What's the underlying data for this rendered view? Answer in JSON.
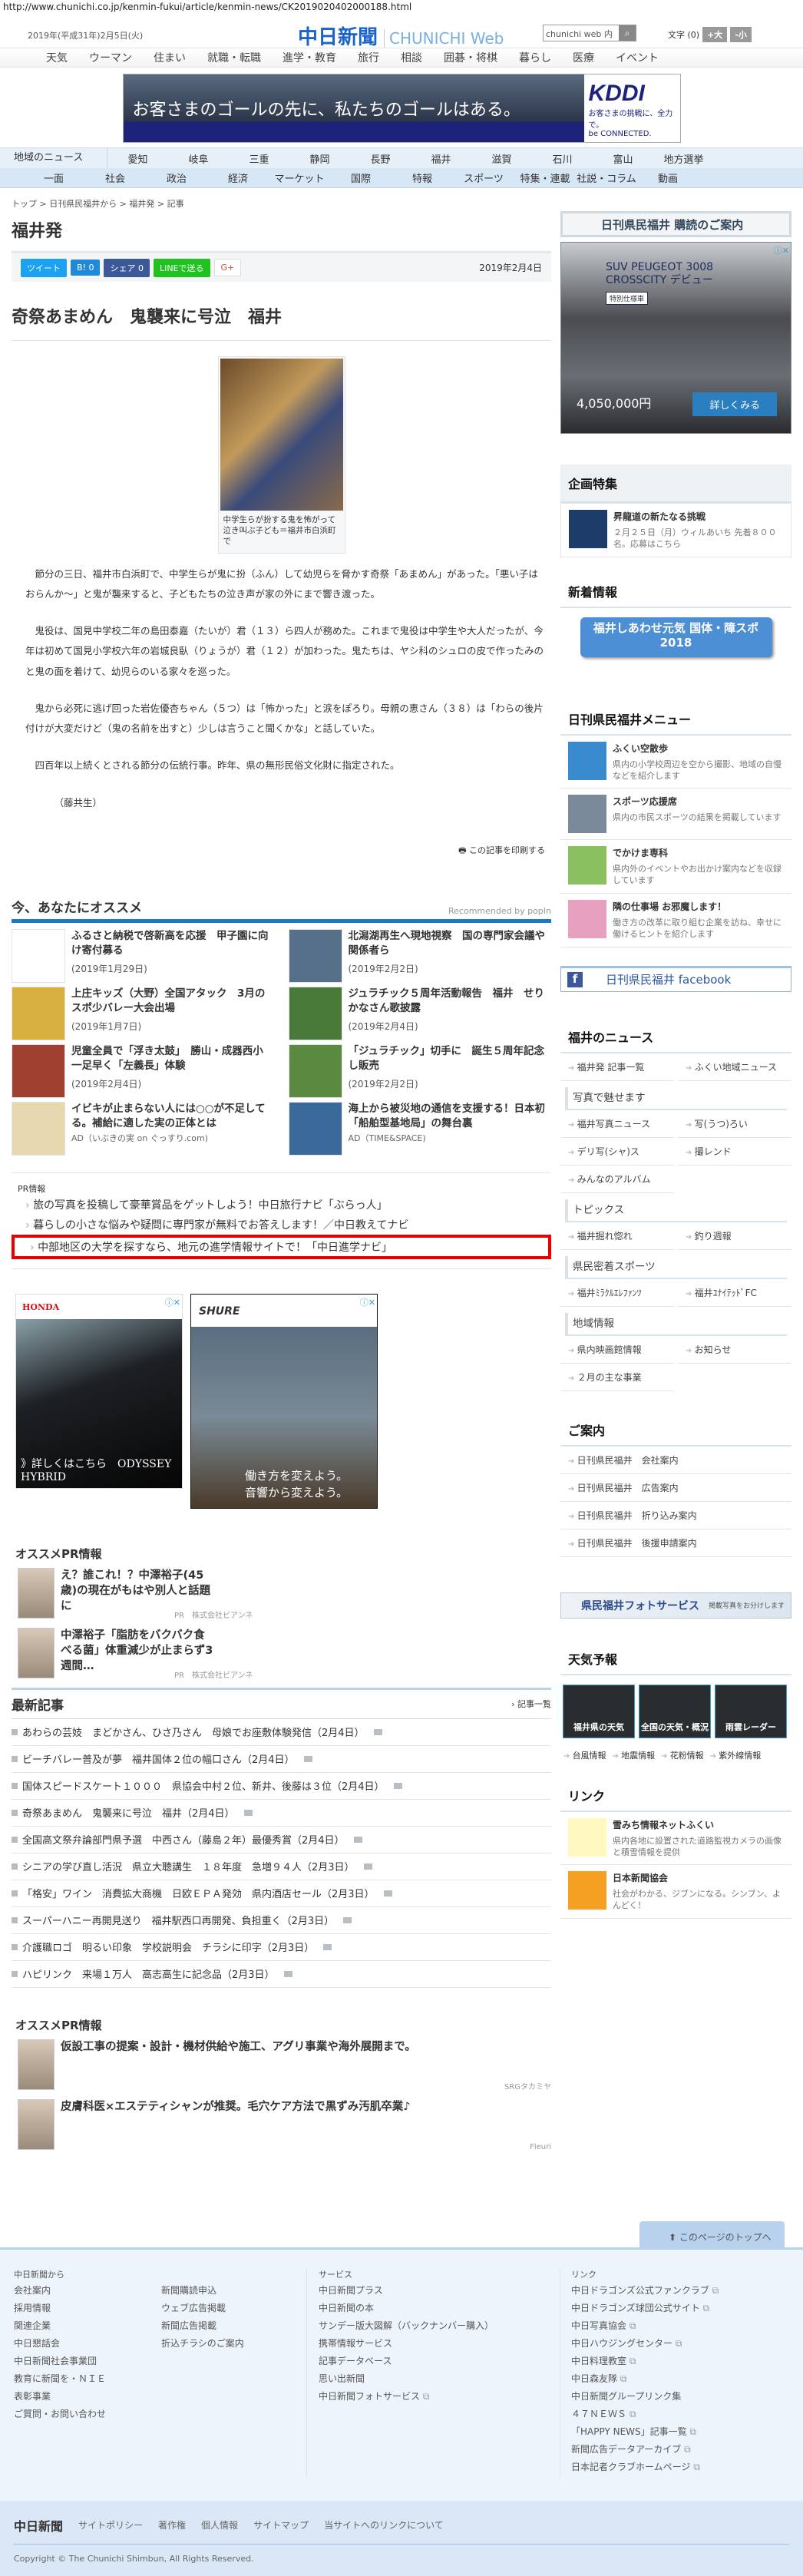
{
  "url": "http://www.chunichi.co.jp/kenmin-fukui/article/kenmin-news/CK2019020402000188.html",
  "header": {
    "date": "2019年(平成31年)2月5日(火)",
    "logo_jp": "中日新聞",
    "logo_en": "CHUNICHI Web",
    "search_placeholder": "chunichi web 内",
    "font_label": "文字 (0)",
    "font_up": "+大",
    "font_down": "-小"
  },
  "global_nav": [
    "天気",
    "ウーマン",
    "住まい",
    "就職・転職",
    "進学・教育",
    "旅行",
    "相談",
    "囲碁・将棋",
    "暮らし",
    "医療",
    "イベント"
  ],
  "top_ad": {
    "text": "お客さまのゴールの先に、私たちのゴールはある。",
    "brand": "KDDI",
    "sub": "お客さまの挑戦に、全力で。",
    "tag": "be CONNECTED."
  },
  "region_nav": {
    "label": "地域のニュース",
    "items": [
      "愛知",
      "岐阜",
      "三重",
      "静岡",
      "長野",
      "福井",
      "滋賀",
      "石川",
      "富山",
      "地方選挙"
    ]
  },
  "category_nav": [
    "一面",
    "社会",
    "政治",
    "経済",
    "マーケット",
    "国際",
    "特報",
    "スポーツ",
    "特集・連載",
    "社説・コラム",
    "動画"
  ],
  "breadcrumb": "トップ > 日刊県民福井から > 福井発 > 記事",
  "section_title": "福井発",
  "share": {
    "tweet": "ツイート",
    "hatena": "B! 0",
    "facebook": "シェア 0",
    "line": "LINEで送る",
    "gplus": "G+",
    "date": "2019年2月4日"
  },
  "article": {
    "headline": "奇祭あまめん　鬼襲来に号泣　福井",
    "caption": "中学生らが扮する鬼を怖がって泣き叫ぶ子ども＝福井市白浜町で",
    "paragraphs": [
      "節分の三日、福井市白浜町で、中学生らが鬼に扮（ふん）して幼児らを脅かす奇祭「あまめん」があった。「悪い子はおらんか～」と鬼が襲来すると、子どもたちの泣き声が家の外にまで響き渡った。",
      "鬼役は、国見中学校二年の島田泰嘉（たいが）君（１３）ら四人が務めた。これまで鬼役は中学生や大人だったが、今年は初めて国見小学校六年の岩城良臥（りょうが）君（１２）が加わった。鬼たちは、ヤシ科のシュロの皮で作ったみのと鬼の面を着けて、幼児らのいる家々を巡った。",
      "鬼から必死に逃げ回った岩佐優杏ちゃん（５つ）は「怖かった」と涙をぽろり。母親の恵さん（３８）は「わらの後片付けが大変だけど（鬼の名前を出すと）少しは言うこと聞くかな」と話していた。",
      "四百年以上続くとされる節分の伝統行事。昨年、県の無形民俗文化財に指定された。"
    ],
    "author": "（藤共生）",
    "print": "この記事を印刷する"
  },
  "recommend": {
    "title": "今、あなたにオススメ",
    "by": "Recommended by popIn",
    "items": [
      {
        "title": "ふるさと納税で啓新高を応援　甲子園に向け寄付募る",
        "meta": "(2019年1月29日)"
      },
      {
        "title": "北潟湖再生へ現地視察　国の専門家会議や関係者ら",
        "meta": "(2019年2月2日)"
      },
      {
        "title": "上庄キッズ（大野）全国アタック　3月のスポ少バレー大会出場",
        "meta": "(2019年1月7日)"
      },
      {
        "title": "ジュラチック５周年活動報告　福井　せりかなさん歌披露",
        "meta": "(2019年2月4日)"
      },
      {
        "title": "児童全員で「浮き太鼓」　勝山・成器西小　一足早く「左義長」体験",
        "meta": "(2019年2月4日)"
      },
      {
        "title": "「ジュラチック」切手に　誕生５周年記念し販売",
        "meta": "(2019年2月2日)"
      },
      {
        "title": "イビキが止まらない人には○○が不足してる。補給に適した実の正体とは",
        "meta": "AD（いぶきの実 on ぐっすり.com)"
      },
      {
        "title": "海上から被災地の通信を支援する！日本初「船舶型基地局」の舞台裏",
        "meta": "AD（TIME&SPACE)"
      }
    ]
  },
  "pr_info": {
    "label": "PR情報",
    "items": [
      "旅の写真を投稿して豪華賞品をゲットしよう！中日旅行ナビ「ぶらっ人」",
      "暮らしの小さな悩みや疑問に専門家が無料でお答えします！／中日教えてナビ",
      "中部地区の大学を探すなら、地元の進学情報サイトで！「中日進学ナビ」"
    ]
  },
  "display_ads": {
    "honda_brand": "HONDA",
    "honda_text": "》詳しくはこちら　ODYSSEY HYBRID",
    "shure_brand": "SHURE",
    "shure_text_1": "働き方を変えよう。",
    "shure_text_2": "音響から変えよう。"
  },
  "pr_recommend_1": {
    "title": "オススメPR情報",
    "items": [
      {
        "title": "え？誰これ！？中澤裕子(45歳)の現在がもはや別人と話題に",
        "source": "PR　株式会社ビアンネ"
      },
      {
        "title": "中澤裕子「脂肪をバクバク食べる菌」体重減少が止まらず3週間…",
        "source": "PR　株式会社ビアンネ"
      }
    ]
  },
  "latest": {
    "title": "最新記事",
    "more": "記事一覧",
    "items": [
      "あわらの芸妓　まどかさん、ひさ乃さん　母娘でお座敷体験発信（2月4日）",
      "ビーチバレー普及が夢　福井国体２位の幅口さん（2月4日）",
      "国体スピードスケート１０００　県協会中村２位、新井、後藤は３位（2月4日）",
      "奇祭あまめん　鬼襲来に号泣　福井（2月4日）",
      "全国高文祭弁論部門県予選　中西さん（藤島２年）最優秀賞（2月4日）",
      "シニアの学び直し活況　県立大聴講生　１８年度　急増９４人（2月3日）",
      "「格安」ワイン　消費拡大商機　日欧ＥＰＡ発効　県内酒店セール（2月3日）",
      "スーパーハニー再開見送り　福井駅西口再開発、負担重く（2月3日）",
      "介護職ロゴ　明るい印象　学校説明会　チラシに印字（2月3日）",
      "ハピリンク　来場１万人　高志高生に記念品（2月3日）"
    ]
  },
  "pr_recommend_2": {
    "title": "オススメPR情報",
    "items": [
      {
        "title": "仮設工事の提案・設計・機材供給や施工、アグリ事業や海外展開まで。",
        "source": "SRGタカミヤ"
      },
      {
        "title": "皮膚科医×エステティシャンが推奨。毛穴ケア方法で黒ずみ汚肌卒業♪",
        "source": "Fleuri"
      }
    ]
  },
  "sidebar": {
    "subscribe": "日刊県民福井 購読のご案内",
    "peugeot": {
      "title": "SUV PEUGEOT 3008 CROSSCITY デビュー",
      "special": "特別仕様車",
      "price": "4,050,000円",
      "button": "詳しくみる"
    },
    "feature": {
      "title": "企画特集",
      "item_title": "昇龍道の新たなる挑戦",
      "item_desc": "２月２５日（月）ウィルあいち 先着８００名。応募はこちら"
    },
    "news": {
      "title": "新着情報",
      "banner": "福井しあわせ元気 国体・障スポ2018"
    },
    "menu": {
      "title": "日刊県民福井メニュー",
      "items": [
        {
          "title": "ふくい空散歩",
          "desc": "県内の小学校周辺を空から撮影、地域の自慢などを紹介します"
        },
        {
          "title": "スポーツ応援席",
          "desc": "県内の市民スポーツの結果を掲載しています"
        },
        {
          "title": "でかけま専科",
          "desc": "県内外のイベントやお出かけ案内などを収録しています"
        },
        {
          "title": "隣の仕事場 お邪魔します！",
          "desc": "働き方の改革に取り組む企業を訪ね、幸せに働けるヒントを紹介します"
        }
      ]
    },
    "facebook": "日刊県民福井 facebook",
    "fukui_news": {
      "title": "福井のニュース",
      "links": [
        "福井発 記事一覧",
        "ふくい地域ニュース"
      ],
      "groups": [
        {
          "title": "写真で魅せます",
          "links": [
            "福井写真ニュース",
            "写(うつ)ろい",
            "デリ写(シャ)ス",
            "撮レンド",
            "みんなのアルバム"
          ]
        },
        {
          "title": "トピックス",
          "links": [
            "福井掘れ惚れ",
            "釣り週報"
          ]
        },
        {
          "title": "県民密着スポーツ",
          "links": [
            "福井ﾐﾗｸﾙｴﾚﾌｧﾝﾂ",
            "福井ﾕﾅｲﾃｯﾄﾞFC"
          ]
        },
        {
          "title": "地域情報",
          "links": [
            "県内映画館情報",
            "お知らせ",
            "２月の主な事業"
          ]
        }
      ]
    },
    "guide": {
      "title": "ご案内",
      "links": [
        "日刊県民福井　会社案内",
        "日刊県民福井　広告案内",
        "日刊県民福井　折り込み案内",
        "日刊県民福井　後援申請案内"
      ]
    },
    "photo_service": {
      "title": "県民福井フォトサービス",
      "sub": "掲載写真をお分けします"
    },
    "weather": {
      "title": "天気予報",
      "tiles": [
        "福井県の天気",
        "全国の天気・概況",
        "雨雲レーダー"
      ],
      "links": [
        "台風情報",
        "地震情報",
        "花粉情報",
        "紫外線情報"
      ]
    },
    "links": {
      "title": "リンク",
      "items": [
        {
          "title": "雪みち情報ネットふくい",
          "desc": "県内各地に設置された道路監視カメラの画像と積雪情報を提供"
        },
        {
          "title": "日本新聞協会",
          "desc": "社会がわかる、ジブンになる。シンブン、よんどく！"
        }
      ]
    }
  },
  "page_top": "このページのトップへ",
  "footer": {
    "col1_title": "中日新聞から",
    "col1": [
      "会社案内",
      "採用情報",
      "関連企業",
      "中日懇話会",
      "中日新聞社会事業団",
      "教育に新聞を・ＮＩＥ",
      "表彰事業",
      "ご質問・お問い合わせ"
    ],
    "col1b": [
      "新聞購読申込",
      "ウェブ広告掲載",
      "新聞広告掲載",
      "折込チラシのご案内"
    ],
    "col2_title": "サービス",
    "col2": [
      "中日新聞プラス",
      "中日新聞の本",
      "サンデー版大図解（バックナンバー購入）",
      "携帯情報サービス",
      "記事データベース",
      "思い出新聞",
      "中日新聞フォトサービス"
    ],
    "col3_title": "リンク",
    "col3": [
      "中日ドラゴンズ公式ファンクラブ",
      "中日ドラゴンズ球団公式サイト",
      "中日写真協会",
      "中日ハウジングセンター",
      "中日料理教室",
      "中日森友隊",
      "中日新聞グループリンク集",
      "４７ＮＥＷＳ",
      "「HAPPY NEWS」記事一覧",
      "新聞広告データアーカイブ",
      "日本記者クラブホームページ"
    ],
    "bottom_logo": "中日新聞",
    "bottom_links": [
      "サイトポリシー",
      "著作権",
      "個人情報",
      "サイトマップ",
      "当サイトへのリンクについて"
    ],
    "copyright": "Copyright © The Chunichi Shimbun, All Rights Reserved."
  },
  "colors": {
    "brand": "#1a63c8",
    "accent_blue": "#1b78c8",
    "highlight_red": "#e60000"
  }
}
